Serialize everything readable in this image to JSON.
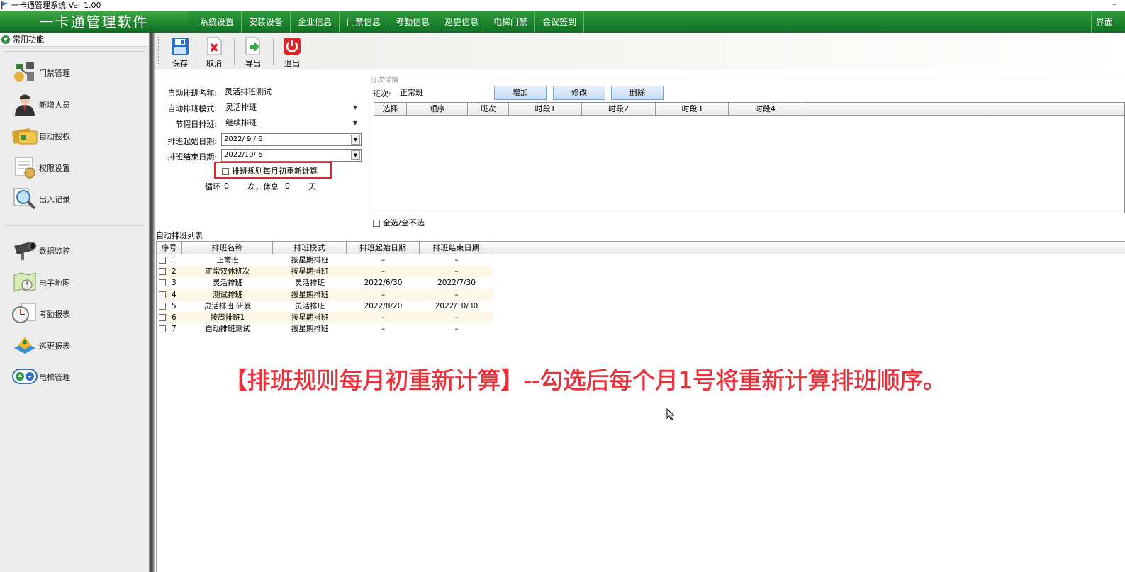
{
  "window": {
    "title": "一卡通管理系统  Ver 1.00",
    "minimize_glyph": "–"
  },
  "topbar": {
    "brand": "一卡通管理软件",
    "menu": [
      "系统设置",
      "安装设备",
      "企业信息",
      "门禁信息",
      "考勤信息",
      "巡更信息",
      "电梯门禁",
      "会议签到"
    ],
    "right_tag": "界面"
  },
  "sidebar": {
    "header": "常用功能",
    "group1": [
      {
        "label": "门禁管理",
        "icon": "access-control-icon"
      },
      {
        "label": "新增人员",
        "icon": "person-icon"
      },
      {
        "label": "自动授权",
        "icon": "card-icon"
      },
      {
        "label": "权限设置",
        "icon": "permission-icon"
      },
      {
        "label": "出入记录",
        "icon": "magnifier-icon"
      }
    ],
    "group2": [
      {
        "label": "数据监控",
        "icon": "camera-icon"
      },
      {
        "label": "电子地图",
        "icon": "map-icon"
      },
      {
        "label": "考勤报表",
        "icon": "clock-icon"
      },
      {
        "label": "巡更报表",
        "icon": "patrol-icon"
      },
      {
        "label": "电梯管理",
        "icon": "elevator-icon"
      }
    ]
  },
  "toolbar": {
    "save": "保存",
    "cancel": "取消",
    "export": "导出",
    "exit": "退出"
  },
  "form": {
    "name_label": "自动排班名称:",
    "name_value": "灵活排班测试",
    "mode_label": "自动排班模式:",
    "mode_value": "灵活排班",
    "holiday_label": "节假日排班:",
    "holiday_value": "继续排班",
    "start_label": "排班起始日期:",
    "start_value": "2022/ 9 / 6",
    "end_label": "排班结束日期:",
    "end_value": "2022/10/ 6",
    "recalc_label": "排班规则每月初重新计算",
    "cycle_prefix": "循环",
    "cycle_value": "0",
    "cycle_mid": "次，休息",
    "rest_value": "0",
    "cycle_suffix": "天"
  },
  "shift_panel": {
    "legend": "班次详情",
    "shift_label": "班次:",
    "shift_value": "正常班",
    "add_button": "增加",
    "edit_button": "修改",
    "delete_button": "删除",
    "columns": [
      "选择",
      "顺序",
      "班次",
      "时段1",
      "时段2",
      "时段3",
      "时段4"
    ],
    "select_all": "全选/全不选"
  },
  "schedule_list": {
    "title": "自动排班列表",
    "columns": [
      "序号",
      "排班名称",
      "排班模式",
      "排班起始日期",
      "排班结束日期"
    ],
    "rows": [
      {
        "id": "1",
        "name": "正常班",
        "mode": "按星期排班",
        "start": "–",
        "end": "–"
      },
      {
        "id": "2",
        "name": "正常双休班次",
        "mode": "按星期排班",
        "start": "–",
        "end": "–"
      },
      {
        "id": "3",
        "name": "灵活排班",
        "mode": "灵活排班",
        "start": "2022/6/30",
        "end": "2022/7/30"
      },
      {
        "id": "4",
        "name": "测试排班",
        "mode": "按星期排班",
        "start": "–",
        "end": "–"
      },
      {
        "id": "5",
        "name": "灵活排班 研发",
        "mode": "灵活排班",
        "start": "2022/8/20",
        "end": "2022/10/30"
      },
      {
        "id": "6",
        "name": "按周排班1",
        "mode": "按星期排班",
        "start": "–",
        "end": "–"
      },
      {
        "id": "7",
        "name": "自动排班测试",
        "mode": "按星期排班",
        "start": "–",
        "end": "–"
      }
    ]
  },
  "caption": "【排班规则每月初重新计算】--勾选后每个月1号将重新计算排班顺序。",
  "colors": {
    "brand_green": "#0f6f23",
    "highlight_red": "#d9282f",
    "caption_red": "#e8313a",
    "alt_row": "#fdf6e4"
  }
}
